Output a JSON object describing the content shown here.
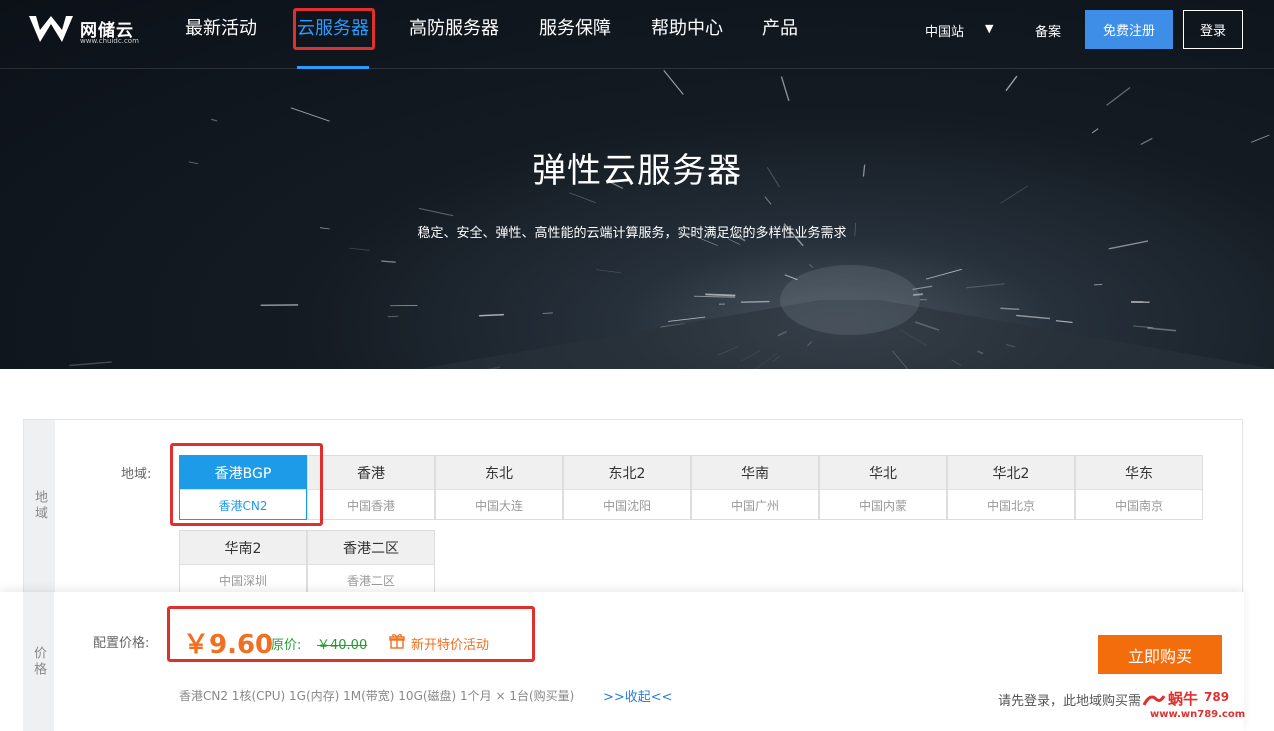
{
  "brand": {
    "name": "网储云",
    "sub": "www.chuidc.com"
  },
  "nav": {
    "items": [
      {
        "label": "最新活动"
      },
      {
        "label": "云服务器"
      },
      {
        "label": "高防服务器"
      },
      {
        "label": "服务保障"
      },
      {
        "label": "帮助中心"
      },
      {
        "label": "产品"
      }
    ],
    "station": "中国站",
    "station_arrow": "▼",
    "beian": "备案",
    "register": "免费注册",
    "login": "登录"
  },
  "hero": {
    "title": "弹性云服务器",
    "subtitle": "稳定、安全、弹性、高性能的云端计算服务，实时满足您的多样性业务需求"
  },
  "region_section": {
    "side_label": "地域",
    "label": "地域:",
    "regions": [
      {
        "name": "香港BGP",
        "sub": "香港CN2",
        "selected": true
      },
      {
        "name": "香港",
        "sub": "中国香港"
      },
      {
        "name": "东北",
        "sub": "中国大连"
      },
      {
        "name": "东北2",
        "sub": "中国沈阳"
      },
      {
        "name": "华南",
        "sub": "中国广州"
      },
      {
        "name": "华北",
        "sub": "中国内蒙"
      },
      {
        "name": "华北2",
        "sub": "中国北京"
      },
      {
        "name": "华东",
        "sub": "中国南京"
      },
      {
        "name": "华南2",
        "sub": "中国深圳"
      },
      {
        "name": "香港二区",
        "sub": "香港二区"
      }
    ]
  },
  "price_section": {
    "side_label": "价格",
    "label": "配置价格:",
    "price": "￥9.60",
    "orig_label": "原价:",
    "orig_price": "￥40.00",
    "promo": "新开特价活动",
    "spec": "香港CN2  1核(CPU)  1G(内存)  1M(带宽)  10G(磁盘)  1个月 × 1台(购买量)",
    "toggle": ">>收起<<",
    "buy": "立即购买",
    "login_hint": "请先登录，此地域购买需"
  },
  "watermark": {
    "text1": "蜗牛",
    "text2": "789",
    "url": "www.wn789.com"
  },
  "colors": {
    "accent": "#1e9be8",
    "nav_active": "#2a9bff",
    "price": "#f26f21",
    "buy": "#f46d0c",
    "highlight_box": "#e0302e",
    "orig_price": "#2a9a37"
  }
}
